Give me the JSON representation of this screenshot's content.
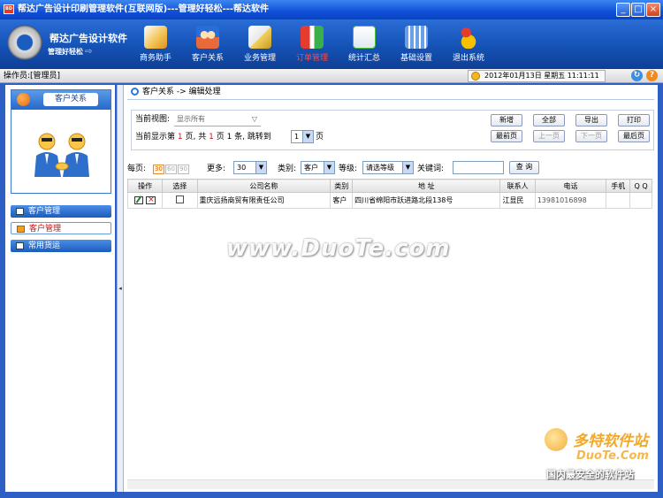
{
  "window": {
    "title": "帮达广告设计印刷管理软件(互联网版)---管理好轻松---帮达软件"
  },
  "brand": {
    "title": "帮达广告设计软件",
    "subtitle": "管理好轻松"
  },
  "toolbar": {
    "items": [
      {
        "label": "商务助手",
        "icon": "handshake-icon",
        "color": "#f2c14e"
      },
      {
        "label": "客户关系",
        "icon": "customers-icon",
        "color": "#e86a3a"
      },
      {
        "label": "业务管理",
        "icon": "document-edit-icon",
        "color": "#f0d060"
      },
      {
        "label": "订单管理",
        "icon": "orders-icon",
        "color": "#e63b2e"
      },
      {
        "label": "统计汇总",
        "icon": "chart-icon",
        "color": "#4cbf3a"
      },
      {
        "label": "基础设置",
        "icon": "settings-icon",
        "color": "#6aa0e8"
      },
      {
        "label": "退出系统",
        "icon": "exit-icon",
        "color": "#f5c000"
      }
    ],
    "active_index": 3
  },
  "status": {
    "operator": "操作员:[管理员]",
    "datetime": "2012年01月13日 星期五 11:11:11"
  },
  "sidebar": {
    "card_title": "客户关系",
    "menu": [
      {
        "label": "客户管理",
        "type": "group"
      },
      {
        "label": "客户管理",
        "type": "item"
      },
      {
        "label": "常用货运",
        "type": "group"
      }
    ]
  },
  "breadcrumb": {
    "path": "客户关系 -> 编辑处理"
  },
  "view": {
    "label": "当前视图:",
    "value": "显示所有",
    "page_prefix": "当前显示第",
    "current_page": "1",
    "page_mid": "页, 共",
    "total_pages": "1",
    "page_suffix": "页 1 条,",
    "jump_label": "跳转到",
    "jump_value": "1",
    "jump_suffix": "页"
  },
  "actions": {
    "add": "新增",
    "select_all": "全部",
    "export": "导出",
    "print": "打印",
    "first": "最前页",
    "prev": "上一页",
    "next": "下一页",
    "last": "最后页"
  },
  "filters": {
    "per_page_label": "每页:",
    "per_page_options": [
      "30",
      "60",
      "90"
    ],
    "more_label": "更多:",
    "more_value": "30",
    "category_label": "类别:",
    "category_value": "客户",
    "level_label": "等级:",
    "level_value": "请选等级",
    "keyword_label": "关键词:",
    "keyword_value": "",
    "search": "查 询"
  },
  "table": {
    "headers": [
      "操作",
      "选择",
      "公司名称",
      "类别",
      "地 址",
      "联系人",
      "电话",
      "手机",
      "Q Q"
    ],
    "rows": [
      {
        "company": "重庆远扬商贸有限责任公司",
        "category": "客户",
        "address": "四川省绵阳市跃进路北段138号",
        "contact": "江显民",
        "phone": "13981016898",
        "mobile": "",
        "qq": ""
      }
    ]
  },
  "watermark": {
    "text": "www.DuoTe.com",
    "corner_brand": "多特软件站",
    "corner_url": "DuoTe.Com",
    "corner_slogan": "国内最安全的软件站"
  }
}
